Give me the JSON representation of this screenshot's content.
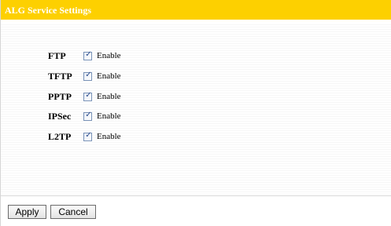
{
  "header": {
    "title": "ALG Service Settings"
  },
  "services": [
    {
      "name": "FTP",
      "checked": true,
      "enable_label": "Enable"
    },
    {
      "name": "TFTP",
      "checked": true,
      "enable_label": "Enable"
    },
    {
      "name": "PPTP",
      "checked": true,
      "enable_label": "Enable"
    },
    {
      "name": "IPSec",
      "checked": true,
      "enable_label": "Enable"
    },
    {
      "name": "L2TP",
      "checked": true,
      "enable_label": "Enable"
    }
  ],
  "buttons": {
    "apply_label": "Apply",
    "cancel_label": "Cancel"
  },
  "colors": {
    "title_bar": "#fdd000",
    "checkbox_border": "#7a93b8",
    "check_mark": "#2a4a8c"
  }
}
